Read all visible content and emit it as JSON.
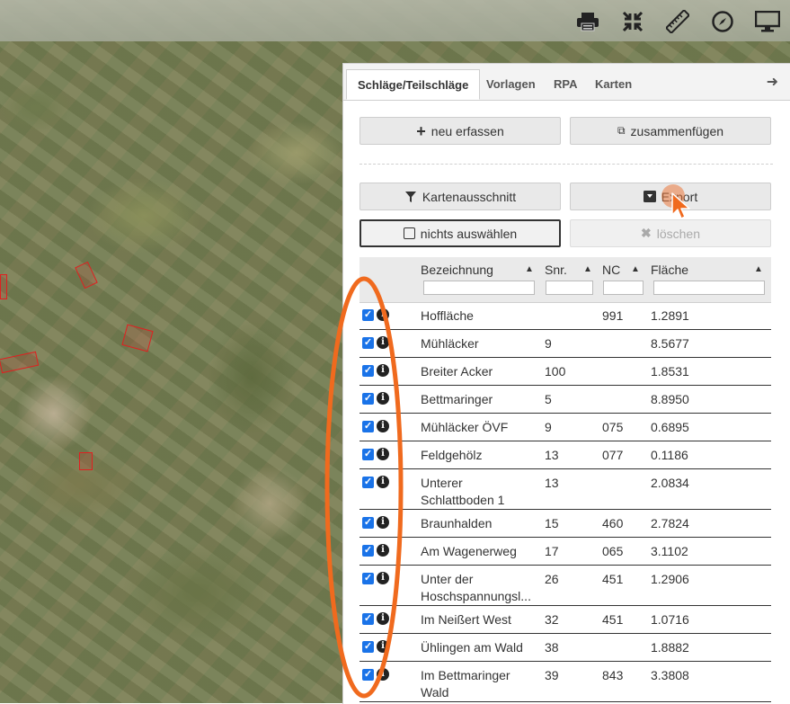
{
  "toolbar": {
    "icons": [
      "print-icon",
      "compress-icon",
      "ruler-icon",
      "compass-icon",
      "monitor-icon"
    ]
  },
  "tabs": [
    {
      "label": "Schläge/Teilschläge",
      "active": true
    },
    {
      "label": "Vorlagen",
      "active": false
    },
    {
      "label": "RPA",
      "active": false
    },
    {
      "label": "Karten",
      "active": false
    }
  ],
  "buttons": {
    "new": "neu erfassen",
    "merge": "zusammenfügen",
    "map_extent": "Kartenausschnitt",
    "export": "Export",
    "select_none": "nichts auswählen",
    "delete": "löschen"
  },
  "table": {
    "columns": [
      "Bezeichnung",
      "Snr.",
      "NC",
      "Fläche"
    ],
    "rows": [
      {
        "name": "Hoffläche",
        "snr": "",
        "nc": "991",
        "area": "1.2891"
      },
      {
        "name": "Mühläcker",
        "snr": "9",
        "nc": "",
        "area": "8.5677"
      },
      {
        "name": "Breiter Acker",
        "snr": "100",
        "nc": "",
        "area": "1.8531"
      },
      {
        "name": "Bettmaringer",
        "snr": "5",
        "nc": "",
        "area": "8.8950"
      },
      {
        "name": "Mühläcker ÖVF",
        "snr": "9",
        "nc": "075",
        "area": "0.6895"
      },
      {
        "name": "Feldgehölz",
        "snr": "13",
        "nc": "077",
        "area": "0.1186"
      },
      {
        "name": "Unterer Schlattboden 1",
        "snr": "13",
        "nc": "",
        "area": "2.0834"
      },
      {
        "name": "Braunhalden",
        "snr": "15",
        "nc": "460",
        "area": "2.7824"
      },
      {
        "name": "Am Wagenerweg",
        "snr": "17",
        "nc": "065",
        "area": "3.1102"
      },
      {
        "name": "Unter der Hoschspannungsl...",
        "snr": "26",
        "nc": "451",
        "area": "1.2906"
      },
      {
        "name": "Im Neißert West",
        "snr": "32",
        "nc": "451",
        "area": "1.0716"
      },
      {
        "name": "Ühlingen am Wald",
        "snr": "38",
        "nc": "",
        "area": "1.8882"
      },
      {
        "name": "Im Bettmaringer Wald",
        "snr": "39",
        "nc": "843",
        "area": "3.3808"
      }
    ]
  },
  "colors": {
    "annotation": "#f06a1e",
    "checkbox": "#1a73e8",
    "parcel_outline": "#e02020"
  }
}
